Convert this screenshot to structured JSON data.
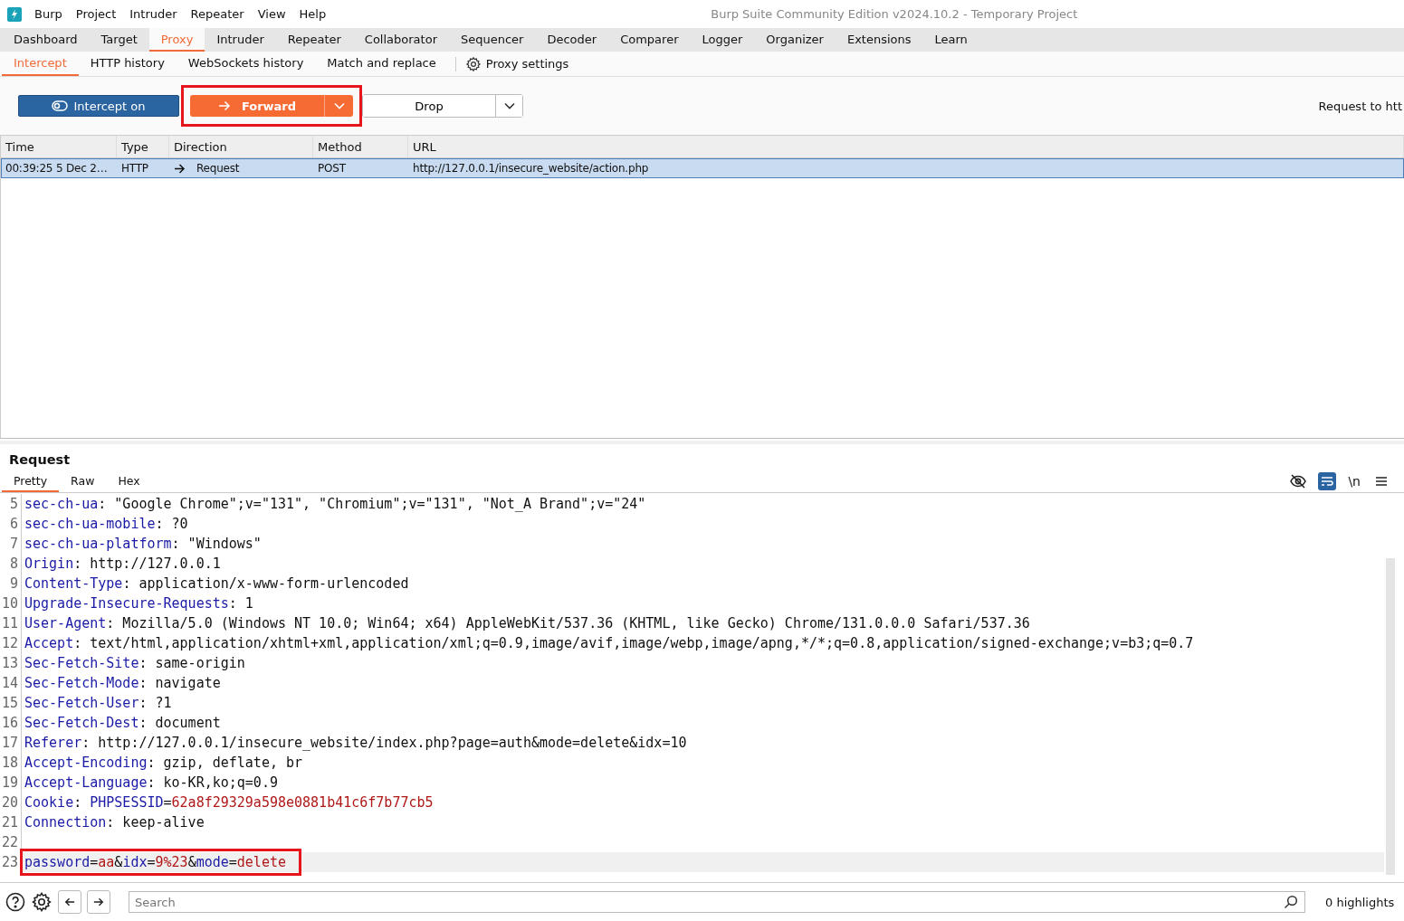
{
  "window": {
    "title": "Burp Suite Community Edition v2024.10.2 - Temporary Project"
  },
  "menu": [
    "Burp",
    "Project",
    "Intruder",
    "Repeater",
    "View",
    "Help"
  ],
  "main_tabs": [
    {
      "label": "Dashboard",
      "selected": false
    },
    {
      "label": "Target",
      "selected": false
    },
    {
      "label": "Proxy",
      "selected": true
    },
    {
      "label": "Intruder",
      "selected": false
    },
    {
      "label": "Repeater",
      "selected": false
    },
    {
      "label": "Collaborator",
      "selected": false
    },
    {
      "label": "Sequencer",
      "selected": false
    },
    {
      "label": "Decoder",
      "selected": false
    },
    {
      "label": "Comparer",
      "selected": false
    },
    {
      "label": "Logger",
      "selected": false
    },
    {
      "label": "Organizer",
      "selected": false
    },
    {
      "label": "Extensions",
      "selected": false
    },
    {
      "label": "Learn",
      "selected": false
    }
  ],
  "sub_tabs": [
    {
      "label": "Intercept",
      "selected": true
    },
    {
      "label": "HTTP history",
      "selected": false
    },
    {
      "label": "WebSockets history",
      "selected": false
    },
    {
      "label": "Match and replace",
      "selected": false
    }
  ],
  "proxy_settings": "Proxy settings",
  "toolbar": {
    "intercept": "Intercept on",
    "forward": {
      "label": "Forward",
      "highlighted": true
    },
    "drop": "Drop",
    "request_info": "Request to htt"
  },
  "table": {
    "columns": [
      "Time",
      "Type",
      "Direction",
      "Method",
      "URL"
    ],
    "rows": [
      {
        "cells": [
          "00:39:25 5 Dec 2…",
          "HTTP",
          "Request",
          "POST",
          "http://127.0.0.1/insecure_website/action.php"
        ],
        "selected": true
      }
    ]
  },
  "request": {
    "title": "Request",
    "tabs": [
      {
        "label": "Pretty",
        "selected": true
      },
      {
        "label": "Raw",
        "selected": false
      },
      {
        "label": "Hex",
        "selected": false
      }
    ],
    "wrap_lines": true,
    "newline_label": "\\n",
    "lines": [
      {
        "number": "5",
        "tokens": [
          {
            "kind": "name",
            "text": "sec-ch-ua"
          },
          {
            "kind": "plain",
            "text": ": \"Google Chrome\";v=\"131\", \"Chromium\";v=\"131\", \"Not_A Brand\";v=\"24\""
          }
        ]
      },
      {
        "number": "6",
        "tokens": [
          {
            "kind": "name",
            "text": "sec-ch-ua-mobile"
          },
          {
            "kind": "plain",
            "text": ": ?0"
          }
        ]
      },
      {
        "number": "7",
        "tokens": [
          {
            "kind": "name",
            "text": "sec-ch-ua-platform"
          },
          {
            "kind": "plain",
            "text": ": \"Windows\""
          }
        ]
      },
      {
        "number": "8",
        "tokens": [
          {
            "kind": "name",
            "text": "Origin"
          },
          {
            "kind": "plain",
            "text": ": http://127.0.0.1"
          }
        ]
      },
      {
        "number": "9",
        "tokens": [
          {
            "kind": "name",
            "text": "Content-Type"
          },
          {
            "kind": "plain",
            "text": ": application/x-www-form-urlencoded"
          }
        ]
      },
      {
        "number": "10",
        "tokens": [
          {
            "kind": "name",
            "text": "Upgrade-Insecure-Requests"
          },
          {
            "kind": "plain",
            "text": ": 1"
          }
        ]
      },
      {
        "number": "11",
        "tokens": [
          {
            "kind": "name",
            "text": "User-Agent"
          },
          {
            "kind": "plain",
            "text": ": Mozilla/5.0 (Windows NT 10.0; Win64; x64) AppleWebKit/537.36 (KHTML, like Gecko) Chrome/131.0.0.0 Safari/537.36"
          }
        ]
      },
      {
        "number": "12",
        "tokens": [
          {
            "kind": "name",
            "text": "Accept"
          },
          {
            "kind": "plain",
            "text": ": text/html,application/xhtml+xml,application/xml;q=0.9,image/avif,image/webp,image/apng,*/*;q=0.8,application/signed-exchange;v=b3;q=0.7"
          }
        ]
      },
      {
        "number": "13",
        "tokens": [
          {
            "kind": "name",
            "text": "Sec-Fetch-Site"
          },
          {
            "kind": "plain",
            "text": ": same-origin"
          }
        ]
      },
      {
        "number": "14",
        "tokens": [
          {
            "kind": "name",
            "text": "Sec-Fetch-Mode"
          },
          {
            "kind": "plain",
            "text": ": navigate"
          }
        ]
      },
      {
        "number": "15",
        "tokens": [
          {
            "kind": "name",
            "text": "Sec-Fetch-User"
          },
          {
            "kind": "plain",
            "text": ": ?1"
          }
        ]
      },
      {
        "number": "16",
        "tokens": [
          {
            "kind": "name",
            "text": "Sec-Fetch-Dest"
          },
          {
            "kind": "plain",
            "text": ": document"
          }
        ]
      },
      {
        "number": "17",
        "tokens": [
          {
            "kind": "name",
            "text": "Referer"
          },
          {
            "kind": "plain",
            "text": ": http://127.0.0.1/insecure_website/index.php?page=auth&mode=delete&idx=10"
          }
        ]
      },
      {
        "number": "18",
        "tokens": [
          {
            "kind": "name",
            "text": "Accept-Encoding"
          },
          {
            "kind": "plain",
            "text": ": gzip, deflate, br"
          }
        ]
      },
      {
        "number": "19",
        "tokens": [
          {
            "kind": "name",
            "text": "Accept-Language"
          },
          {
            "kind": "plain",
            "text": ": ko-KR,ko;q=0.9"
          }
        ]
      },
      {
        "number": "20",
        "tokens": [
          {
            "kind": "name",
            "text": "Cookie"
          },
          {
            "kind": "plain",
            "text": ": "
          },
          {
            "kind": "name",
            "text": "PHPSESSID"
          },
          {
            "kind": "plain",
            "text": "="
          },
          {
            "kind": "value",
            "text": "62a8f29329a598e0881b41c6f7b77cb5"
          }
        ]
      },
      {
        "number": "21",
        "tokens": [
          {
            "kind": "name",
            "text": "Connection"
          },
          {
            "kind": "plain",
            "text": ": keep-alive"
          }
        ]
      },
      {
        "number": "22"
      },
      {
        "number": "23",
        "highlighted": true,
        "tokens": [
          {
            "kind": "name",
            "text": "password"
          },
          {
            "kind": "plain",
            "text": "="
          },
          {
            "kind": "value",
            "text": "aa"
          },
          {
            "kind": "plain",
            "text": "&"
          },
          {
            "kind": "name",
            "text": "idx"
          },
          {
            "kind": "plain",
            "text": "="
          },
          {
            "kind": "value",
            "text": "9%23"
          },
          {
            "kind": "plain",
            "text": "&"
          },
          {
            "kind": "name",
            "text": "mode"
          },
          {
            "kind": "plain",
            "text": "="
          },
          {
            "kind": "value",
            "text": "delete"
          }
        ]
      }
    ]
  },
  "search": {
    "placeholder": "Search",
    "highlights": "0 highlights"
  }
}
